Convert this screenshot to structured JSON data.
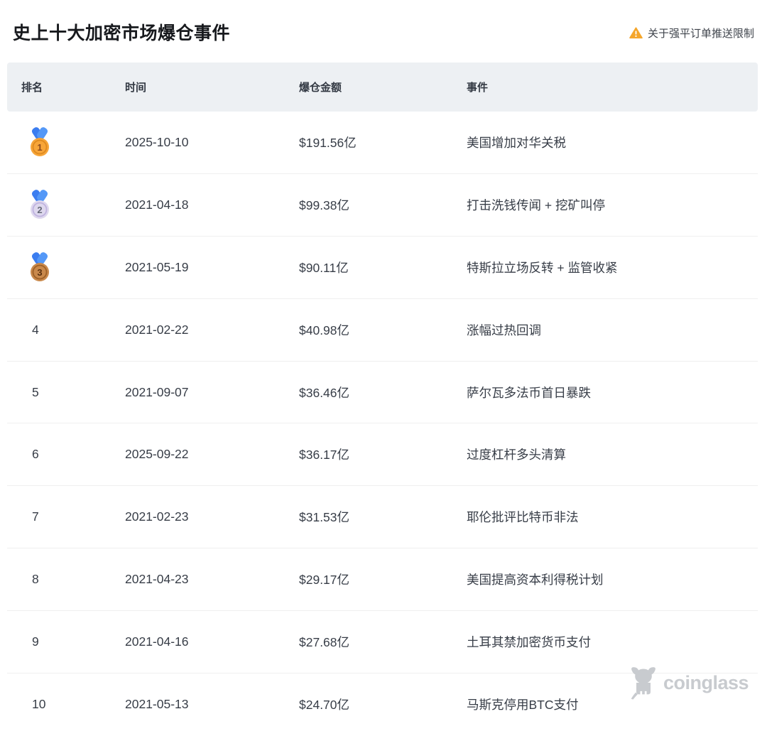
{
  "page": {
    "title": "史上十大加密市场爆仓事件"
  },
  "notice": {
    "label": "关于强平订单推送限制",
    "icon": "warning-triangle-icon",
    "icon_color": "#F5A62B"
  },
  "table": {
    "columns": [
      "排名",
      "时间",
      "爆仓金额",
      "事件"
    ],
    "rows": [
      {
        "rank": "1",
        "medal": "gold",
        "date": "2025-10-10",
        "amount": "$191.56亿",
        "event": "美国增加对华关税"
      },
      {
        "rank": "2",
        "medal": "silver",
        "date": "2021-04-18",
        "amount": "$99.38亿",
        "event": "打击洗钱传闻 + 挖矿叫停"
      },
      {
        "rank": "3",
        "medal": "bronze",
        "date": "2021-05-19",
        "amount": "$90.11亿",
        "event": "特斯拉立场反转 + 监管收紧"
      },
      {
        "rank": "4",
        "medal": null,
        "date": "2021-02-22",
        "amount": "$40.98亿",
        "event": "涨幅过热回调"
      },
      {
        "rank": "5",
        "medal": null,
        "date": "2021-09-07",
        "amount": "$36.46亿",
        "event": "萨尔瓦多法币首日暴跌"
      },
      {
        "rank": "6",
        "medal": null,
        "date": "2025-09-22",
        "amount": "$36.17亿",
        "event": "过度杠杆多头清算"
      },
      {
        "rank": "7",
        "medal": null,
        "date": "2021-02-23",
        "amount": "$31.53亿",
        "event": "耶伦批评比特币非法"
      },
      {
        "rank": "8",
        "medal": null,
        "date": "2021-04-23",
        "amount": "$29.17亿",
        "event": "美国提高资本利得税计划"
      },
      {
        "rank": "9",
        "medal": null,
        "date": "2021-04-16",
        "amount": "$27.68亿",
        "event": "土耳其禁加密货币支付"
      },
      {
        "rank": "10",
        "medal": null,
        "date": "2021-05-13",
        "amount": "$24.70亿",
        "event": "马斯克停用BTC支付"
      }
    ],
    "medal_colors": {
      "gold": {
        "coin": "#F7A539",
        "ring": "#DE8A1F",
        "number": "#8C4A1D"
      },
      "silver": {
        "coin": "#DED8EE",
        "ring": "#BFB2DF",
        "number": "#646876"
      },
      "bronze": {
        "coin": "#C9894C",
        "ring": "#9E6026",
        "number": "#59300F"
      },
      "ribbon": "#3B7DF0"
    },
    "header_bg": "#EDF0F3"
  },
  "watermark": {
    "label": "coinglass",
    "icon": "bull-mascot-icon",
    "color": "#C8CBCF"
  }
}
